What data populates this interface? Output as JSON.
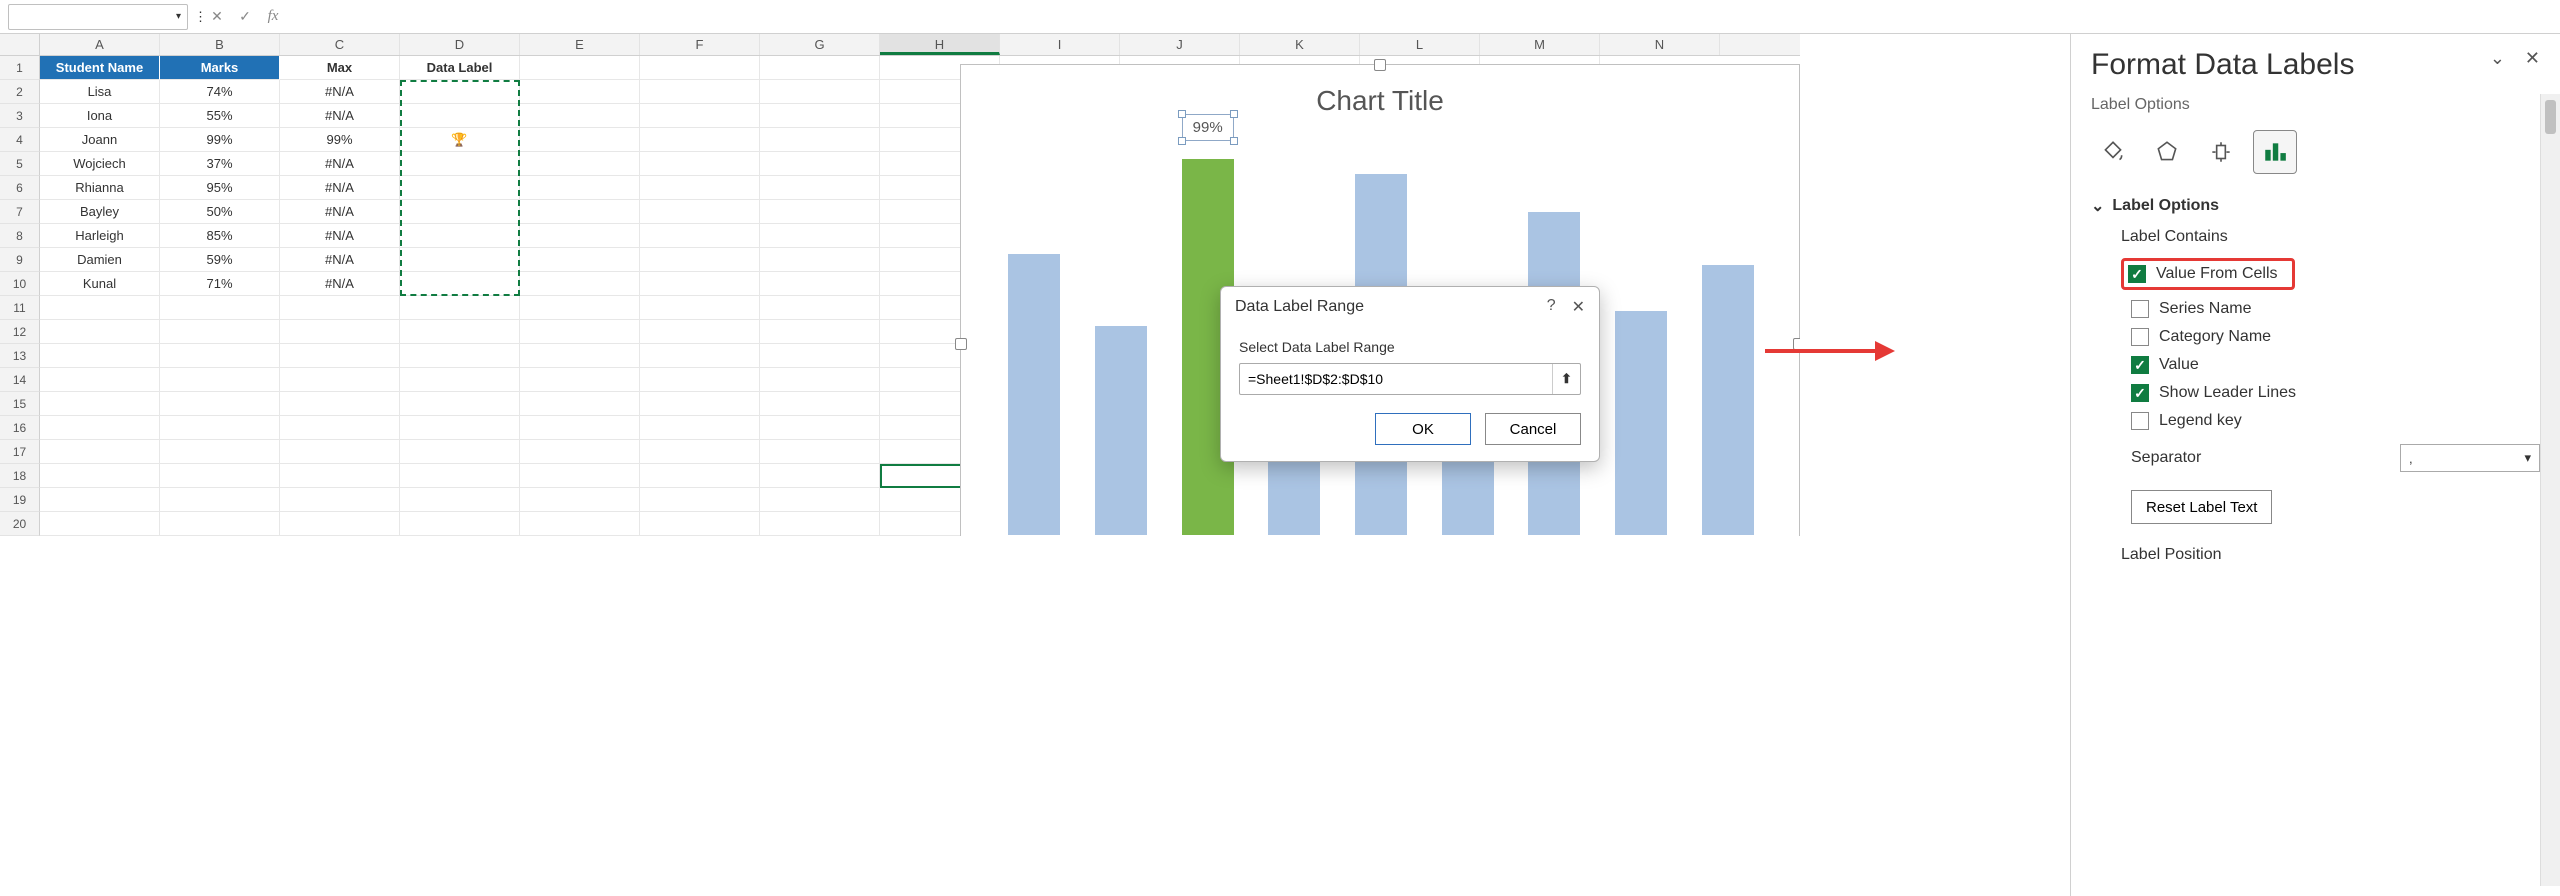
{
  "formula_bar": {
    "name_box": "",
    "fx_label": "fx",
    "formula": ""
  },
  "columns": [
    "A",
    "B",
    "C",
    "D",
    "E",
    "F",
    "G",
    "H",
    "I",
    "J",
    "K",
    "L",
    "M",
    "N"
  ],
  "row_numbers": [
    1,
    2,
    3,
    4,
    5,
    6,
    7,
    8,
    9,
    10,
    11,
    12,
    13,
    14,
    15,
    16,
    17,
    18,
    19,
    20
  ],
  "headers": {
    "student": "Student Name",
    "marks": "Marks",
    "max": "Max",
    "data_label": "Data Label"
  },
  "rows": [
    {
      "name": "Lisa",
      "marks": "74%",
      "max": "#N/A",
      "label": ""
    },
    {
      "name": "Iona",
      "marks": "55%",
      "max": "#N/A",
      "label": ""
    },
    {
      "name": "Joann",
      "marks": "99%",
      "max": "99%",
      "label": "🏆"
    },
    {
      "name": "Wojciech",
      "marks": "37%",
      "max": "#N/A",
      "label": ""
    },
    {
      "name": "Rhianna",
      "marks": "95%",
      "max": "#N/A",
      "label": ""
    },
    {
      "name": "Bayley",
      "marks": "50%",
      "max": "#N/A",
      "label": ""
    },
    {
      "name": "Harleigh",
      "marks": "85%",
      "max": "#N/A",
      "label": ""
    },
    {
      "name": "Damien",
      "marks": "59%",
      "max": "#N/A",
      "label": ""
    },
    {
      "name": "Kunal",
      "marks": "71%",
      "max": "#N/A",
      "label": ""
    }
  ],
  "chart": {
    "title": "Chart Title",
    "data_label": "99%"
  },
  "chart_data": {
    "type": "bar",
    "title": "Chart Title",
    "xlabel": "",
    "ylabel": "",
    "ylim": [
      0,
      100
    ],
    "categories": [
      "Lisa",
      "Iona",
      "Joann",
      "Wojciech",
      "Rhianna",
      "Bayley",
      "Harleigh",
      "Damien",
      "Kunal"
    ],
    "series": [
      {
        "name": "Marks",
        "values": [
          74,
          55,
          99,
          37,
          95,
          50,
          85,
          59,
          71
        ],
        "color": "#aac4e3"
      },
      {
        "name": "Max",
        "values": [
          null,
          null,
          99,
          null,
          null,
          null,
          null,
          null,
          null
        ],
        "color": "#7ab648",
        "data_label": "99%"
      }
    ]
  },
  "dialog": {
    "title": "Data Label Range",
    "prompt": "Select Data Label Range",
    "value": "=Sheet1!$D$2:$D$10",
    "ok": "OK",
    "cancel": "Cancel"
  },
  "panel": {
    "title": "Format Data Labels",
    "subtitle": "Label Options",
    "section": "Label Options",
    "subheader": "Label Contains",
    "checks": {
      "value_from_cells": "Value From Cells",
      "series_name": "Series Name",
      "category_name": "Category Name",
      "value": "Value",
      "leader_lines": "Show Leader Lines",
      "legend_key": "Legend key"
    },
    "separator_label": "Separator",
    "separator_value": ",",
    "reset": "Reset Label Text",
    "position_label": "Label Position"
  }
}
